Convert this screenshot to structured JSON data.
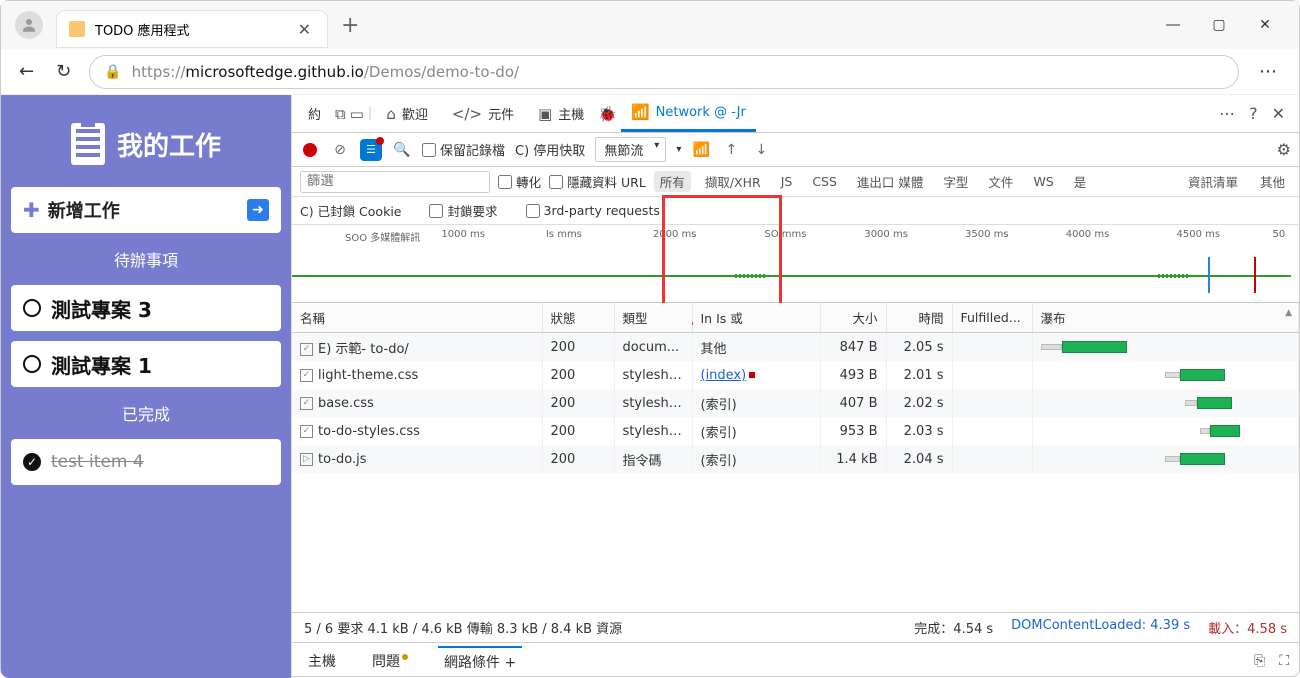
{
  "browser": {
    "tab_title": "TODO 應用程式",
    "url_prefix": "https://",
    "url_host": "microsoftedge.github.io",
    "url_path": "/Demos/demo-to-do/"
  },
  "app": {
    "title": "我的工作",
    "add_label": "新增工作",
    "pending_header": "待辦事項",
    "done_header": "已完成",
    "todos": [
      {
        "label": "測試專案 3"
      },
      {
        "label": "測試專案 1"
      }
    ],
    "done": [
      {
        "label": "test item 4"
      }
    ]
  },
  "devtools": {
    "tabs": {
      "about": "約",
      "welcome": "歡迎",
      "elements": "元件",
      "host": "主機",
      "network": "Network @ -Jr"
    },
    "toolbar": {
      "preserve": "保留記錄檔",
      "disable_cache": "C) 停用快取",
      "throttle": "無節流"
    },
    "filter": {
      "placeholder": "篩選",
      "invert": "轉化",
      "hide_data": "隱藏資料 URL",
      "types": {
        "all": "所有",
        "fetch": "擷取/XHR",
        "js": "JS",
        "css": "CSS",
        "img": "進出口 媒體",
        "font": "字型",
        "doc": "文件",
        "ws": "WS",
        "wasm": "是"
      },
      "manifest": "資訊清單",
      "other": "其他"
    },
    "row2": {
      "blocked": "C) 已封鎖 Cookie",
      "block_req": "封鎖要求",
      "third_party": "3rd-party requests"
    },
    "timeline_ticks": [
      "SOO 多媒體解訊",
      "1000 ms",
      "Is  mms",
      "2000 ms",
      "SO mms",
      "3000 ms",
      "3500 ms",
      "4000 ms",
      "4500 ms",
      "50"
    ],
    "table": {
      "cols": {
        "name": "名稱",
        "status": "狀態",
        "type": "類型",
        "initiator": "In Is 或",
        "size": "大小",
        "time": "時間",
        "fulfilled": "Fulfilled...",
        "waterfall": "瀑布"
      },
      "rows": [
        {
          "name": "E) 示範- to-do/",
          "status": "200",
          "type": "docum...",
          "initiator": "其他",
          "size": "847 B",
          "time": "2.05 s",
          "wf_start": 0,
          "wf_len": 26
        },
        {
          "name": "light-theme.css",
          "status": "200",
          "type": "styleshe...",
          "initiator": "(index)",
          "link": true,
          "size": "493 B",
          "time": "2.01 s",
          "wf_start": 50,
          "wf_len": 18,
          "red": true
        },
        {
          "name": "base.css",
          "status": "200",
          "type": "styleshe...",
          "initiator": "(索引)",
          "size": "407 B",
          "time": "2.02 s",
          "wf_start": 58,
          "wf_len": 14
        },
        {
          "name": "to-do-styles.css",
          "status": "200",
          "type": "styleshe...",
          "initiator": "(索引)",
          "size": "953 B",
          "time": "2.03 s",
          "wf_start": 64,
          "wf_len": 12
        },
        {
          "name": "to-do.js",
          "status": "200",
          "type": "指令碼",
          "initiator": "(索引)",
          "size": "1.4 kB",
          "time": "2.04 s",
          "wf_start": 50,
          "wf_len": 18
        }
      ]
    },
    "status": {
      "summary": "5 / 6 要求 4.1 kB / 4.6 kB 傳輸 8.3 kB / 8.4 kB 資源",
      "finish_label": "完成：",
      "finish": "4.54 s",
      "dcl_label": "DOMContentLoaded: ",
      "dcl": "4.39 s",
      "load_label": "載入：",
      "load": "4.58 s"
    },
    "drawer": {
      "host": "主機",
      "issues": "問題",
      "network_cond": "網路條件 +"
    }
  }
}
